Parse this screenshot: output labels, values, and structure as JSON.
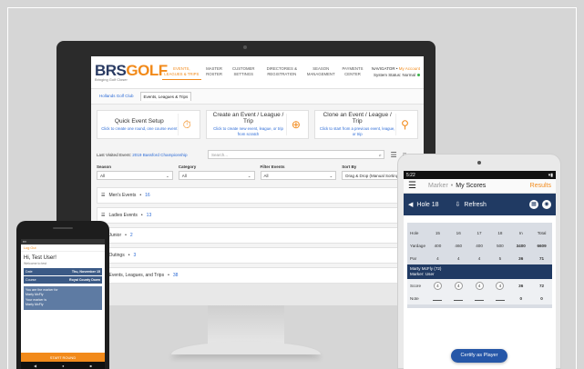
{
  "desktop": {
    "logo_brs": "BRS",
    "logo_golf": "GOLF",
    "logo_tagline": "Bringing Golf Closer",
    "nav": [
      "EVENTS, LEAGUES & TRIPS",
      "MASTER ROSTER",
      "CUSTOMER SETTINGS",
      "DIRECTORIES & REGISTRATION",
      "SEASON MANAGEMENT",
      "PAYMENTS CENTER"
    ],
    "navigator_label": "NAVIGATOR",
    "account_label": "My Account",
    "status_label": "System Status: Normal",
    "tabs": [
      "Hollands Golf Club",
      "Events, Leagues & Trips"
    ],
    "cards": [
      {
        "title": "Quick Event Setup",
        "sub": "Click to create one round, one course event"
      },
      {
        "title": "Create an Event / League / Trip",
        "sub": "Click to create new event, league, or trip from scratch"
      },
      {
        "title": "Clone an Event / League / Trip",
        "sub": "Click to start from a previous event, league, or trip"
      }
    ],
    "last_visited_prefix": "Last Visited Event:",
    "last_visited_event": "2019 Bassford Championship",
    "search_placeholder": "Search...",
    "filters": [
      {
        "label": "Season",
        "value": "All"
      },
      {
        "label": "Category",
        "value": "All"
      },
      {
        "label": "Filter Events",
        "value": "All"
      },
      {
        "label": "Sort By",
        "value": "Drag & Drop (Manual Sorting)"
      }
    ],
    "groups": [
      {
        "name": "Men's Events",
        "count": "16"
      },
      {
        "name": "Ladies Events",
        "count": "13"
      },
      {
        "name": "Junior",
        "count": "2"
      },
      {
        "name": "Outings",
        "count": "3"
      },
      {
        "name": "Events, Leagues, and Trips",
        "count": "38"
      }
    ]
  },
  "phone": {
    "header": "Log Out",
    "greeting": "Hi, Test User!",
    "welcome": "Welcome to test",
    "date_label": "Date",
    "date_value": "Thu, November 15",
    "course_label": "Course",
    "course_value": "Royal County Down",
    "marker_line1": "You are the marker for",
    "marker_name1": "Marty McFly",
    "marker_line2": "Your marker is",
    "marker_name2": "Marty McFly",
    "button": "START ROUND"
  },
  "tablet": {
    "time": "5:22",
    "marker_tab": "Marker",
    "myscores_tab": "My Scores",
    "results_tab": "Results",
    "hole_label": "Hole 18",
    "refresh_label": "Refresh",
    "scorecard": {
      "holes": [
        "15",
        "16",
        "17",
        "18",
        "In",
        "Total"
      ],
      "yardage": [
        "400",
        "460",
        "400",
        "500",
        "3400",
        "6609"
      ],
      "par": [
        "4",
        "4",
        "4",
        "5",
        "36",
        "71"
      ],
      "player": "Marty McFly (72)",
      "marker": "Marker: User",
      "score": [
        "4",
        "4",
        "4",
        "4",
        "36",
        "72"
      ],
      "note": [
        "",
        "",
        "",
        "",
        "0",
        "0"
      ]
    },
    "certify_label": "Certify as Player"
  }
}
